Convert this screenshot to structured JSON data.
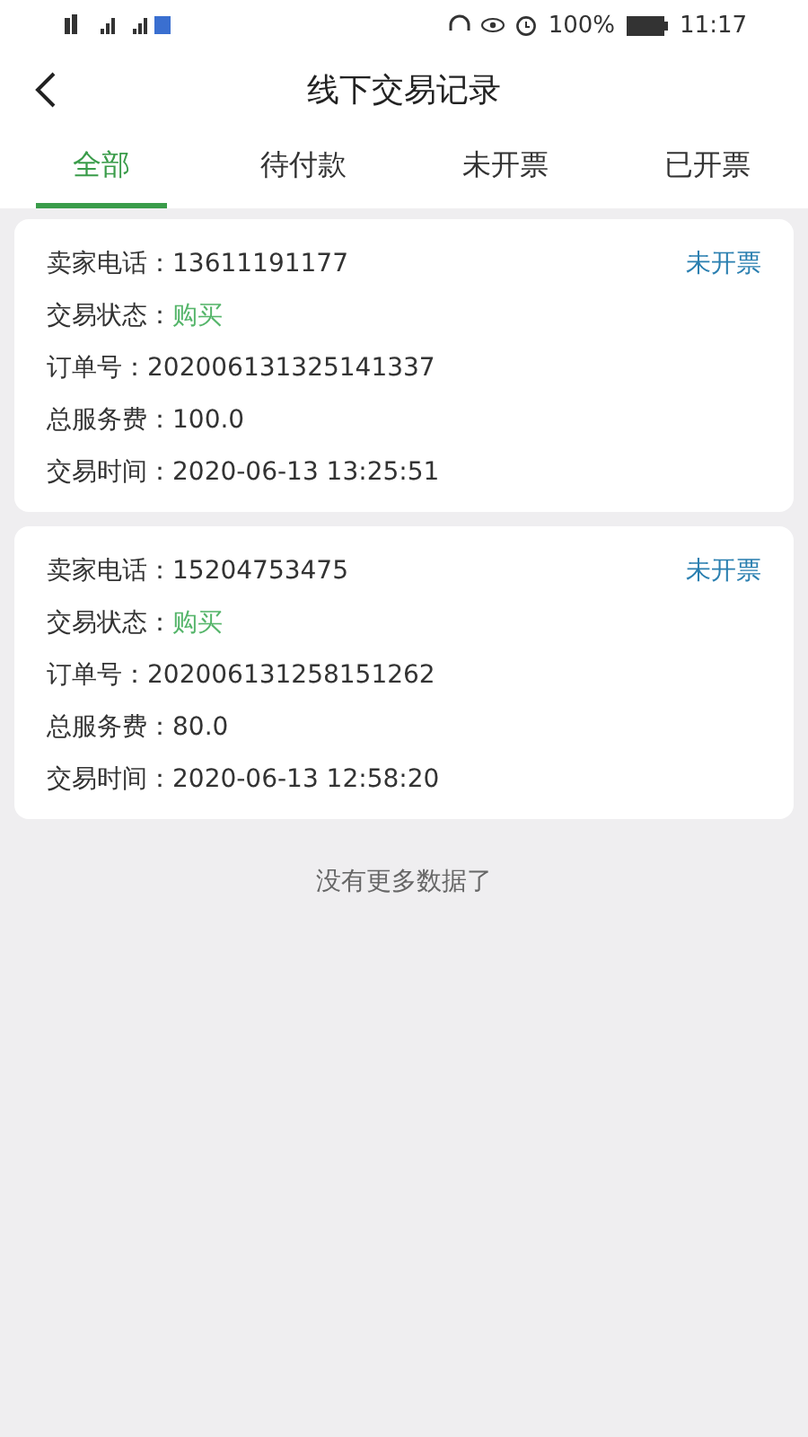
{
  "status_bar": {
    "battery": "100%",
    "time": "11:17"
  },
  "header": {
    "title": "线下交易记录"
  },
  "tabs": [
    {
      "label": "全部",
      "selected": true
    },
    {
      "label": "待付款",
      "selected": false
    },
    {
      "label": "未开票",
      "selected": false
    },
    {
      "label": "已开票",
      "selected": false
    }
  ],
  "records": [
    {
      "phone_label": "卖家电话：",
      "phone": "13611191177",
      "invoice_status": "未开票",
      "rows": [
        {
          "label": "交易状态：",
          "value": "购买",
          "kind": "status"
        },
        {
          "label": "订单号：",
          "value": "202006131325141337",
          "kind": "plain"
        },
        {
          "label": "总服务费：",
          "value": "100.0",
          "kind": "plain"
        },
        {
          "label": "交易时间：",
          "value": "2020-06-13 13:25:51",
          "kind": "plain"
        }
      ]
    },
    {
      "phone_label": "卖家电话：",
      "phone": "15204753475",
      "invoice_status": "未开票",
      "rows": [
        {
          "label": "交易状态：",
          "value": "购买",
          "kind": "status"
        },
        {
          "label": "订单号：",
          "value": "202006131258151262",
          "kind": "plain"
        },
        {
          "label": "总服务费：",
          "value": "80.0",
          "kind": "plain"
        },
        {
          "label": "交易时间：",
          "value": "2020-06-13 12:58:20",
          "kind": "plain"
        }
      ]
    }
  ],
  "footer": "没有更多数据了"
}
